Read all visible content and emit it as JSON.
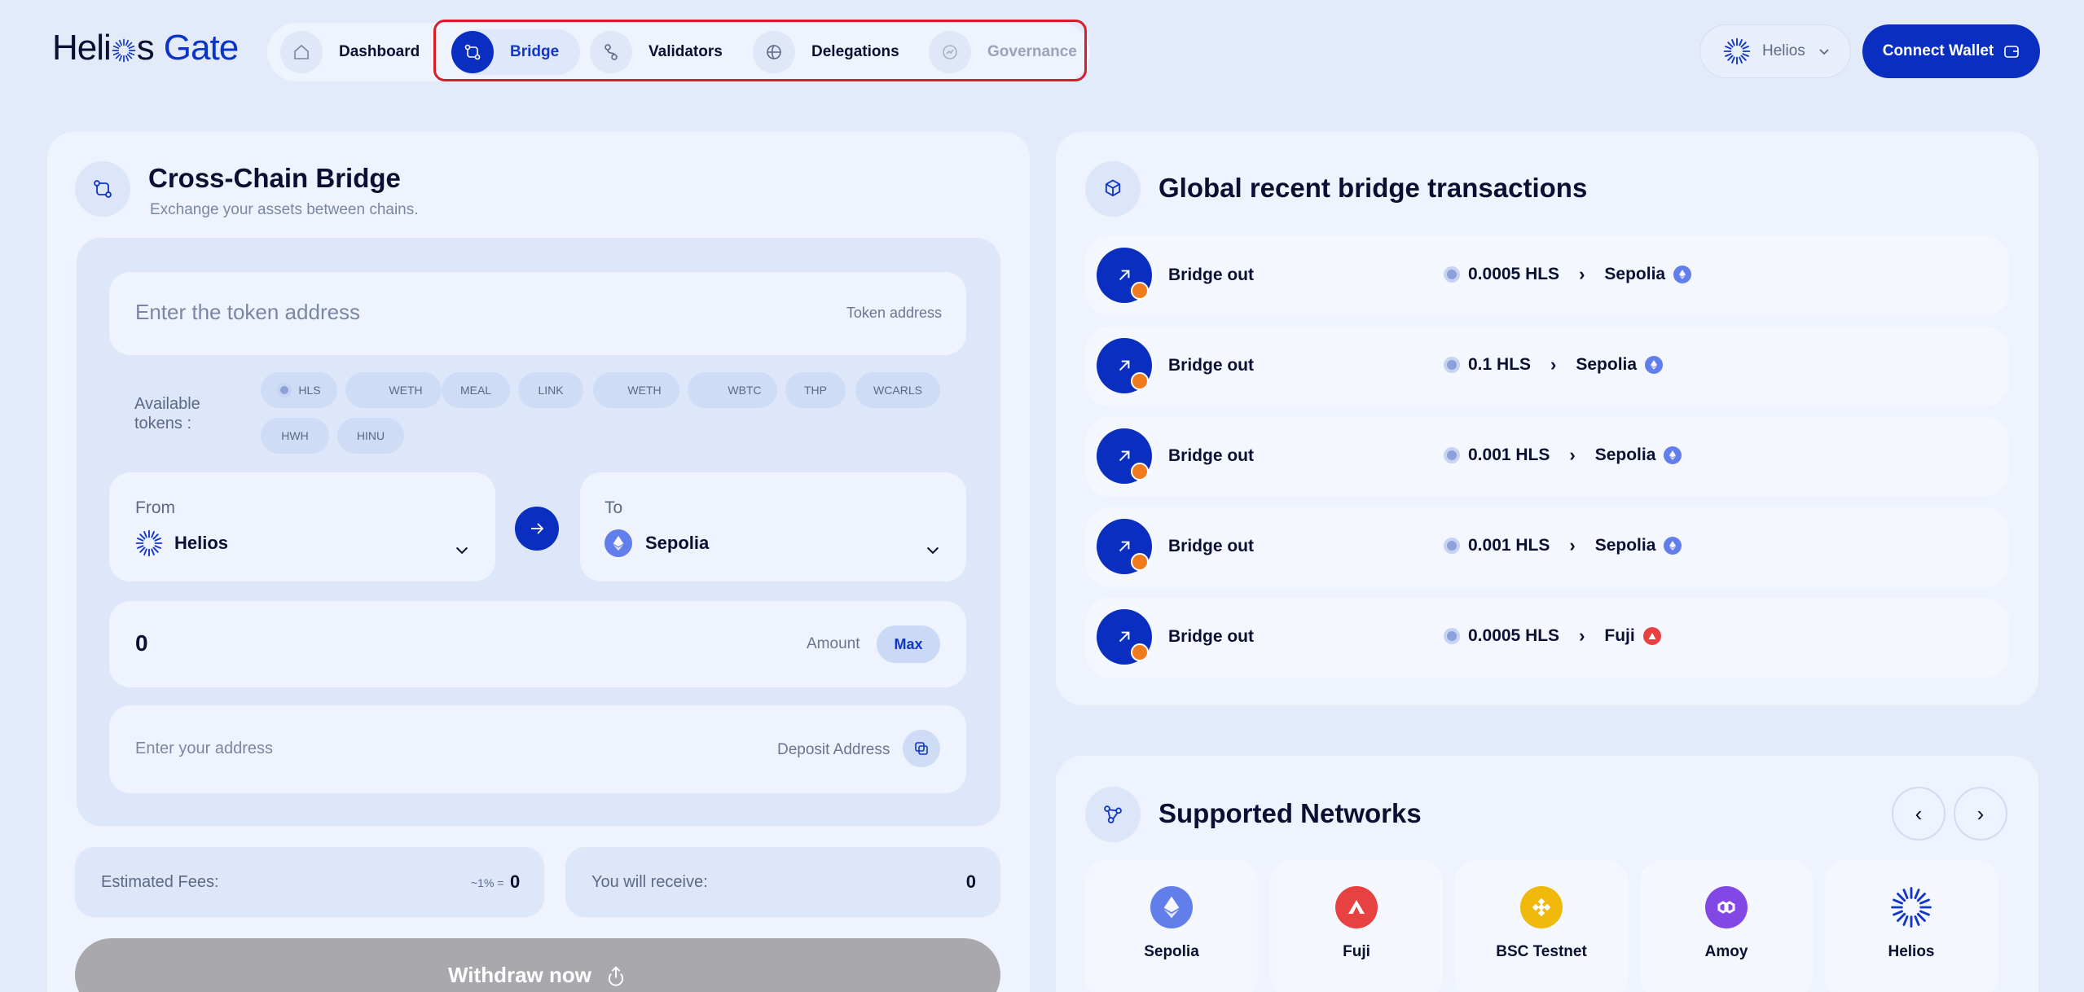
{
  "brand": {
    "name_left": "Heli",
    "name_mid": "s",
    "name_right": "Gate"
  },
  "nav": {
    "items": [
      {
        "label": "Dashboard",
        "icon": "home-icon"
      },
      {
        "label": "Bridge",
        "icon": "bridge-icon",
        "active": true
      },
      {
        "label": "Validators",
        "icon": "validators-icon"
      },
      {
        "label": "Delegations",
        "icon": "delegations-icon"
      },
      {
        "label": "Governance",
        "icon": "governance-icon",
        "disabled": true
      }
    ]
  },
  "header": {
    "network_label": "Helios",
    "connect_label": "Connect Wallet"
  },
  "bridge": {
    "title": "Cross-Chain Bridge",
    "subtitle": "Exchange your assets between chains.",
    "token_placeholder": "Enter the token address",
    "token_label": "Token address",
    "available_label": "Available tokens :",
    "tokens": [
      "HLS",
      "WETH",
      "MEAL",
      "LINK",
      "WETH",
      "WBTC",
      "THP",
      "WCARLS",
      "HWH",
      "HINU"
    ],
    "from_label": "From",
    "from_value": "Helios",
    "to_label": "To",
    "to_value": "Sepolia",
    "amount_value": "0",
    "amount_label": "Amount",
    "max_label": "Max",
    "address_placeholder": "Enter your address",
    "address_label": "Deposit Address",
    "fees_label": "Estimated Fees:",
    "fees_percent": "~1% =",
    "fees_value": "0",
    "receive_label": "You will receive:",
    "receive_value": "0",
    "withdraw_label": "Withdraw now"
  },
  "transactions": {
    "title": "Global recent bridge transactions",
    "rows": [
      {
        "type": "Bridge out",
        "amount": "0.0005 HLS",
        "network": "Sepolia",
        "network_icon": "ethereum-icon"
      },
      {
        "type": "Bridge out",
        "amount": "0.1 HLS",
        "network": "Sepolia",
        "network_icon": "ethereum-icon"
      },
      {
        "type": "Bridge out",
        "amount": "0.001 HLS",
        "network": "Sepolia",
        "network_icon": "ethereum-icon"
      },
      {
        "type": "Bridge out",
        "amount": "0.001 HLS",
        "network": "Sepolia",
        "network_icon": "ethereum-icon"
      },
      {
        "type": "Bridge out",
        "amount": "0.0005 HLS",
        "network": "Fuji",
        "network_icon": "avalanche-icon"
      }
    ]
  },
  "networks": {
    "title": "Supported Networks",
    "items": [
      {
        "name": "Sepolia",
        "icon": "ethereum-icon",
        "color": "#627eea"
      },
      {
        "name": "Fuji",
        "icon": "avalanche-icon",
        "color": "#e84142"
      },
      {
        "name": "BSC Testnet",
        "icon": "bnb-icon",
        "color": "#f0b90b"
      },
      {
        "name": "Amoy",
        "icon": "polygon-icon",
        "color": "#8247e5"
      },
      {
        "name": "Helios",
        "icon": "helios-sun-icon",
        "color": "#1236c7"
      }
    ]
  },
  "colors": {
    "accent": "#0a2fc0",
    "background": "#e3ebfb",
    "highlight_box": "#d91c2a",
    "disabled_button": "#a9a9ad"
  }
}
